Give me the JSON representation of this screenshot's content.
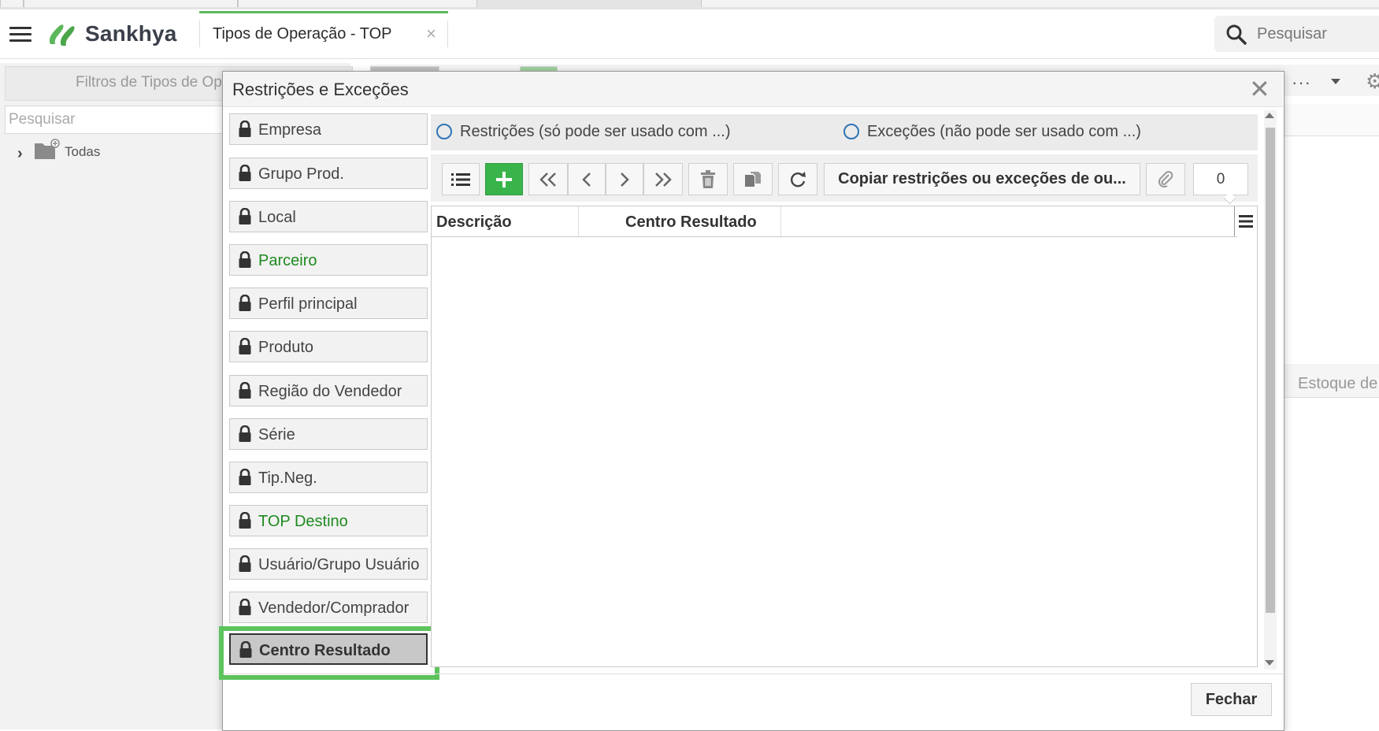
{
  "app": {
    "brand": "Sankhya",
    "menu_icon": "hamburger-menu-icon",
    "tab": {
      "title": "Tipos de Operação - TOP",
      "close": "×"
    },
    "search": {
      "placeholder": "Pesquisar"
    }
  },
  "background": {
    "filters_label": "Filtros de Tipos de Op",
    "search_placeholder": "Pesquisar",
    "tree_item": "Todas",
    "more_label": "···",
    "estoque_label": "Estoque de"
  },
  "dialog": {
    "title": "Restrições e Exceções",
    "close": "✕",
    "categories": [
      {
        "label": "Empresa",
        "state": "normal"
      },
      {
        "label": "Grupo Prod.",
        "state": "normal"
      },
      {
        "label": "Local",
        "state": "normal"
      },
      {
        "label": "Parceiro",
        "state": "highlighted"
      },
      {
        "label": "Perfil principal",
        "state": "normal"
      },
      {
        "label": "Produto",
        "state": "normal"
      },
      {
        "label": "Região do Vendedor",
        "state": "normal"
      },
      {
        "label": "Série",
        "state": "normal"
      },
      {
        "label": "Tip.Neg.",
        "state": "normal"
      },
      {
        "label": "TOP Destino",
        "state": "highlighted"
      },
      {
        "label": "Usuário/Grupo Usuário",
        "state": "normal"
      },
      {
        "label": "Vendedor/Comprador",
        "state": "normal"
      },
      {
        "label": "Centro Resultado",
        "state": "selected"
      }
    ],
    "radio_options": [
      {
        "label": "Restrições (só pode ser usado com ...)",
        "selected": false
      },
      {
        "label": "Exceções (não pode ser usado com ...)",
        "selected": false
      }
    ],
    "toolbar": {
      "buttons": [
        "list-view",
        "add",
        "first",
        "previous",
        "next",
        "last",
        "delete",
        "duplicate",
        "refresh"
      ],
      "copy_label": "Copiar restrições ou exceções de ou...",
      "attachment_icon": "paperclip-icon",
      "attachment_count": "0"
    },
    "grid": {
      "columns": [
        "Descrição",
        "Centro Resultado"
      ],
      "rows": []
    },
    "close_button": "Fechar"
  },
  "colors": {
    "accent_green": "#38b44a",
    "highlight_text_green": "#1e8a1e",
    "radio_blue": "#2f75b5",
    "selection_ring": "#5dc35d"
  }
}
